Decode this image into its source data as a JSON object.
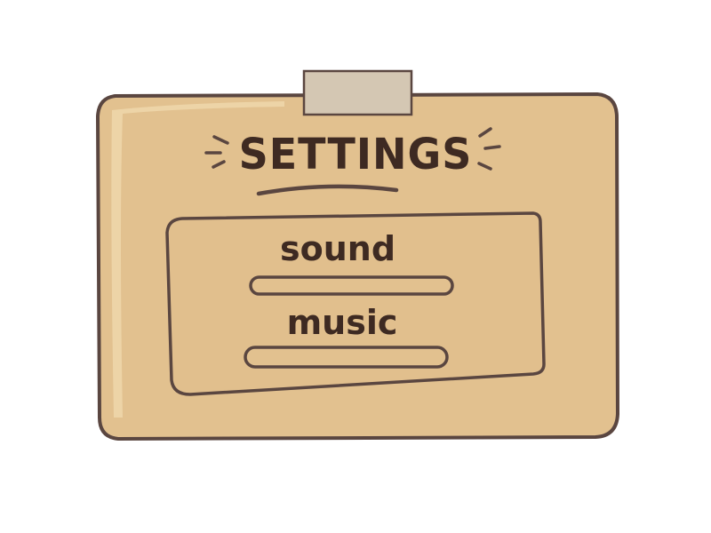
{
  "panel": {
    "title": "SETTINGS",
    "colors": {
      "panel_fill": "#e2c18f",
      "panel_highlight": "#efd7ab",
      "outline": "#5a4640",
      "tape": "#d4c7b3",
      "text": "#3e2a22"
    }
  },
  "settings": [
    {
      "label": "sound",
      "value": 0
    },
    {
      "label": "music",
      "value": 0
    }
  ]
}
